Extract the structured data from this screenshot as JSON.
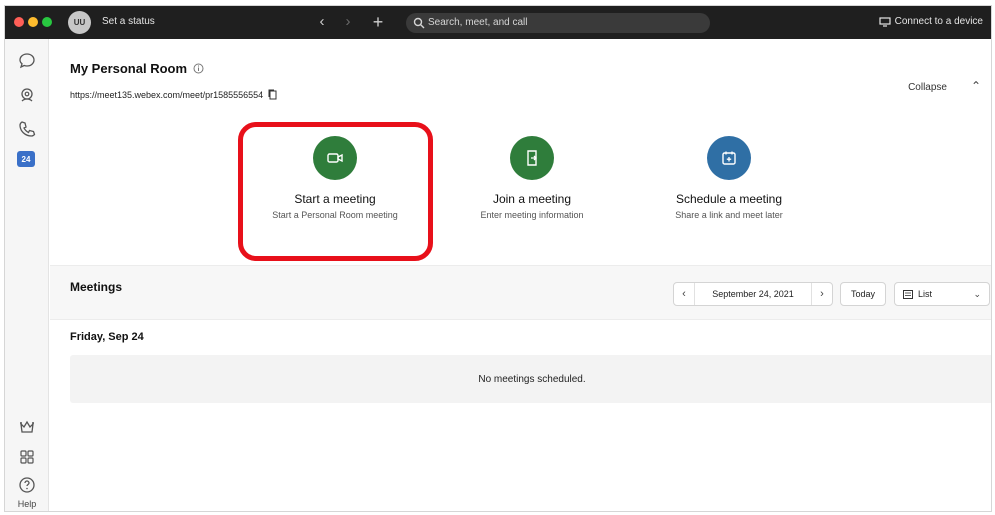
{
  "titlebar": {
    "avatar_initials": "UU",
    "status": "Set a status",
    "search_placeholder": "Search, meet, and call",
    "connect_device": "Connect to a device"
  },
  "rail": {
    "items": [
      {
        "icon": "chat-bubble-icon"
      },
      {
        "icon": "team-icon"
      },
      {
        "icon": "phone-icon"
      },
      {
        "icon": "calendar-icon",
        "badge": "24"
      }
    ],
    "bottom": [
      {
        "icon": "crown-icon"
      },
      {
        "icon": "apps-grid-icon"
      },
      {
        "icon": "help-icon",
        "label": "Help"
      }
    ]
  },
  "room": {
    "title": "My Personal Room",
    "url": "https://meet135.webex.com/meet/pr1585556554",
    "collapse_label": "Collapse"
  },
  "actions": [
    {
      "title": "Start a meeting",
      "subtitle": "Start a Personal Room meeting",
      "color": "#2f7d3b",
      "icon": "video-camera-icon"
    },
    {
      "title": "Join a meeting",
      "subtitle": "Enter meeting information",
      "color": "#2f7d3b",
      "icon": "join-door-icon"
    },
    {
      "title": "Schedule a meeting",
      "subtitle": "Share a link and meet later",
      "color": "#2f6fa5",
      "icon": "calendar-plus-icon"
    }
  ],
  "meetings": {
    "title": "Meetings",
    "date": "September 24, 2021",
    "today_label": "Today",
    "view_label": "List",
    "day_label": "Friday, Sep 24",
    "empty_text": "No meetings scheduled."
  },
  "colors": {
    "highlight": "#e8101a",
    "green": "#2f7d3b",
    "blue": "#2f6fa5",
    "titlebar": "#1f1f1f"
  }
}
